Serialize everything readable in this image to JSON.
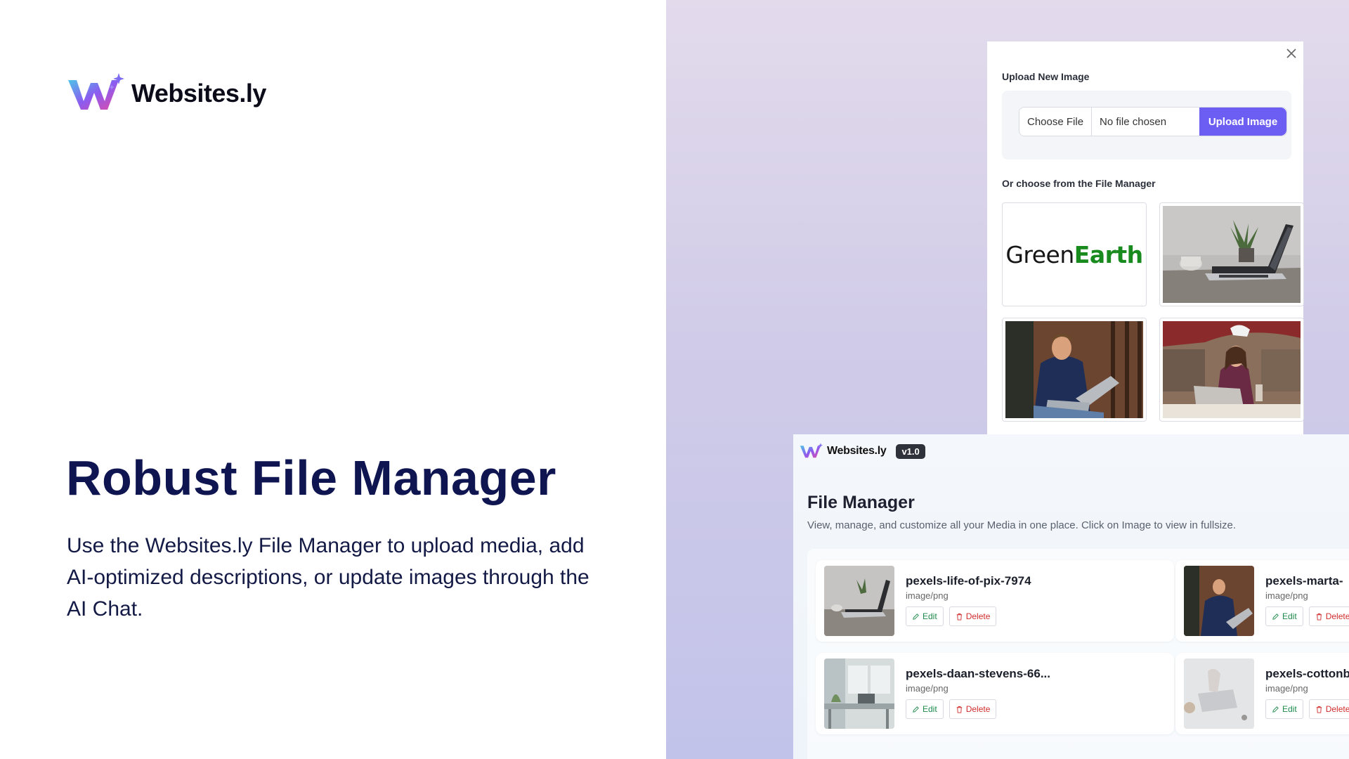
{
  "brand": {
    "name": "Websites.ly"
  },
  "hero": {
    "title": "Robust File Manager",
    "description": "Use the Websites.ly File Manager to upload media, add AI-optimized descriptions, or update images through the AI Chat."
  },
  "upload_dialog": {
    "heading": "Upload New Image",
    "choose_file_label": "Choose File",
    "file_status": "No file chosen",
    "upload_button": "Upload Image",
    "file_manager_heading": "Or choose from the File Manager",
    "images": [
      {
        "kind": "logo",
        "logo_part1": "Green",
        "logo_part2": "Earth"
      },
      {
        "kind": "photo",
        "icon": "laptop-desk-photo"
      },
      {
        "kind": "photo",
        "icon": "man-laptop-photo"
      },
      {
        "kind": "photo",
        "icon": "woman-laptop-photo"
      }
    ]
  },
  "file_manager": {
    "brand": "Websites.ly",
    "version": "v1.0",
    "title": "File Manager",
    "description": "View, manage, and customize all your Media in one place. Click on Image to view in fullsize.",
    "edit_label": "Edit",
    "delete_label": "Delete",
    "files": [
      {
        "name": "pexels-life-of-pix-7974",
        "type": "image/png"
      },
      {
        "name": "pexels-marta-",
        "type": "image/png"
      },
      {
        "name": "pexels-daan-stevens-66...",
        "type": "image/png"
      },
      {
        "name": "pexels-cottonb",
        "type": "image/png"
      }
    ]
  },
  "colors": {
    "accent": "#6d5ef3",
    "headline": "#0f1550",
    "logo_green": "#188a1e",
    "edit_green": "#1f8a4c",
    "delete_red": "#d12c2c"
  }
}
